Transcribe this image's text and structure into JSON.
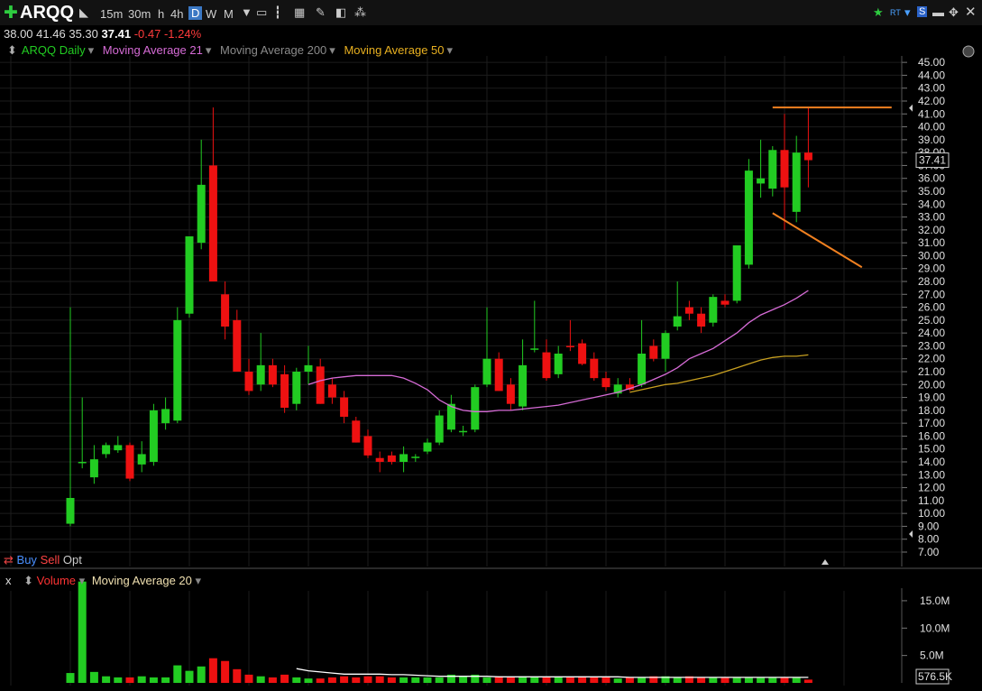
{
  "toolbar": {
    "symbol": "ARQQ",
    "timeframes": [
      "15m",
      "30m",
      "h",
      "4h",
      "D",
      "W",
      "M"
    ],
    "selected_timeframe": "D"
  },
  "ohlc": {
    "open": "38.00",
    "high": "41.46",
    "low": "35.30",
    "close": "37.41",
    "change": "-0.47",
    "change_pct": "-1.24%"
  },
  "legend": {
    "main": "ARQQ Daily",
    "ma21": "Moving Average 21",
    "ma200": "Moving Average 200",
    "ma50": "Moving Average 50"
  },
  "trade": {
    "buy": "Buy",
    "sell": "Sell",
    "opt": "Opt"
  },
  "volume_panel": {
    "close": "x",
    "label": "Volume",
    "ma": "Moving Average 20"
  },
  "colors": {
    "up": "#22cc22",
    "down": "#ee1111",
    "ma21": "#d66bd6",
    "ma50": "#c8a020",
    "ma200": "#999999",
    "trend": "#f08020",
    "vol_ma": "#ffffff"
  },
  "chart_data": {
    "type": "candlestick",
    "ylim": [
      7,
      45.5
    ],
    "y_ticks": [
      "7.00",
      "8.00",
      "9.00",
      "10.00",
      "11.00",
      "12.00",
      "13.00",
      "14.00",
      "15.00",
      "16.00",
      "17.00",
      "18.00",
      "19.00",
      "20.00",
      "21.00",
      "22.00",
      "23.00",
      "24.00",
      "25.00",
      "26.00",
      "27.00",
      "28.00",
      "29.00",
      "30.00",
      "31.00",
      "32.00",
      "33.00",
      "34.00",
      "35.00",
      "36.00",
      "37.00",
      "38.00",
      "39.00",
      "40.00",
      "41.00",
      "42.00",
      "43.00",
      "44.00",
      "45.00"
    ],
    "last_price": "37.41",
    "candles": [
      {
        "o": 9.2,
        "h": 26,
        "l": 9.0,
        "c": 11.2
      },
      {
        "o": 14,
        "h": 19,
        "l": 13.5,
        "c": 14
      },
      {
        "o": 12.8,
        "h": 15.3,
        "l": 12.3,
        "c": 14.2
      },
      {
        "o": 14.6,
        "h": 15.5,
        "l": 14.3,
        "c": 15.3
      },
      {
        "o": 14.9,
        "h": 16.0,
        "l": 14.7,
        "c": 15.3
      },
      {
        "o": 15.3,
        "h": 15.5,
        "l": 12.5,
        "c": 12.7
      },
      {
        "o": 13.8,
        "h": 15.6,
        "l": 13.2,
        "c": 14.6
      },
      {
        "o": 14.0,
        "h": 18.5,
        "l": 13.7,
        "c": 18.0
      },
      {
        "o": 17.0,
        "h": 19.0,
        "l": 16.5,
        "c": 18.1
      },
      {
        "o": 17.2,
        "h": 26.0,
        "l": 17.0,
        "c": 25.0
      },
      {
        "o": 25.5,
        "h": 31.5,
        "l": 25.2,
        "c": 31.5
      },
      {
        "o": 31.0,
        "h": 39.0,
        "l": 30.5,
        "c": 35.5
      },
      {
        "o": 37.0,
        "h": 41.5,
        "l": 28.0,
        "c": 28.0
      },
      {
        "o": 27.0,
        "h": 28.0,
        "l": 23.5,
        "c": 24.5
      },
      {
        "o": 25.0,
        "h": 25.8,
        "l": 21.0,
        "c": 21.0
      },
      {
        "o": 21.0,
        "h": 22.0,
        "l": 19.2,
        "c": 19.5
      },
      {
        "o": 20.0,
        "h": 24.0,
        "l": 19.5,
        "c": 21.5
      },
      {
        "o": 21.5,
        "h": 22.0,
        "l": 19.8,
        "c": 20.0
      },
      {
        "o": 20.8,
        "h": 21.5,
        "l": 17.8,
        "c": 18.2
      },
      {
        "o": 18.5,
        "h": 21.3,
        "l": 18.0,
        "c": 21.0
      },
      {
        "o": 21.0,
        "h": 23.0,
        "l": 20.0,
        "c": 21.5
      },
      {
        "o": 21.4,
        "h": 22.0,
        "l": 18.5,
        "c": 18.5
      },
      {
        "o": 20.0,
        "h": 20.5,
        "l": 18.5,
        "c": 19.0
      },
      {
        "o": 19.0,
        "h": 19.5,
        "l": 17.0,
        "c": 17.5
      },
      {
        "o": 17.2,
        "h": 17.5,
        "l": 15.5,
        "c": 15.5
      },
      {
        "o": 16.0,
        "h": 16.5,
        "l": 14.3,
        "c": 14.5
      },
      {
        "o": 14.3,
        "h": 14.8,
        "l": 13.2,
        "c": 14.0
      },
      {
        "o": 14.5,
        "h": 14.8,
        "l": 13.8,
        "c": 14.0
      },
      {
        "o": 14.0,
        "h": 15.2,
        "l": 13.2,
        "c": 14.6
      },
      {
        "o": 14.3,
        "h": 14.6,
        "l": 14.0,
        "c": 14.4
      },
      {
        "o": 14.8,
        "h": 15.8,
        "l": 14.6,
        "c": 15.5
      },
      {
        "o": 15.5,
        "h": 18.0,
        "l": 15.3,
        "c": 17.6
      },
      {
        "o": 16.5,
        "h": 19.2,
        "l": 16.3,
        "c": 18.5
      },
      {
        "o": 16.4,
        "h": 16.8,
        "l": 16.0,
        "c": 16.4
      },
      {
        "o": 16.5,
        "h": 20.0,
        "l": 16.3,
        "c": 19.8
      },
      {
        "o": 20.0,
        "h": 26.0,
        "l": 19.8,
        "c": 22.0
      },
      {
        "o": 22.0,
        "h": 22.5,
        "l": 19.5,
        "c": 19.5
      },
      {
        "o": 20.0,
        "h": 20.5,
        "l": 18.0,
        "c": 18.5
      },
      {
        "o": 18.3,
        "h": 23.5,
        "l": 18.0,
        "c": 21.5
      },
      {
        "o": 22.8,
        "h": 26.5,
        "l": 22.5,
        "c": 22.8
      },
      {
        "o": 22.5,
        "h": 23.5,
        "l": 20.3,
        "c": 20.5
      },
      {
        "o": 20.8,
        "h": 23.0,
        "l": 20.5,
        "c": 22.4
      },
      {
        "o": 23.0,
        "h": 25.0,
        "l": 22.6,
        "c": 22.9
      },
      {
        "o": 23.2,
        "h": 23.5,
        "l": 21.5,
        "c": 21.6
      },
      {
        "o": 22.0,
        "h": 22.5,
        "l": 20.3,
        "c": 20.5
      },
      {
        "o": 20.5,
        "h": 21.0,
        "l": 19.5,
        "c": 19.8
      },
      {
        "o": 19.3,
        "h": 20.5,
        "l": 19.0,
        "c": 20.0
      },
      {
        "o": 20.0,
        "h": 20.5,
        "l": 19.5,
        "c": 19.6
      },
      {
        "o": 20.0,
        "h": 25.0,
        "l": 19.8,
        "c": 22.4
      },
      {
        "o": 23.0,
        "h": 23.5,
        "l": 21.8,
        "c": 22.0
      },
      {
        "o": 22.0,
        "h": 24.2,
        "l": 21.0,
        "c": 24.0
      },
      {
        "o": 24.5,
        "h": 28.0,
        "l": 24.2,
        "c": 25.3
      },
      {
        "o": 26.0,
        "h": 26.5,
        "l": 25.0,
        "c": 25.5
      },
      {
        "o": 25.5,
        "h": 26.0,
        "l": 24.0,
        "c": 24.5
      },
      {
        "o": 24.8,
        "h": 27.0,
        "l": 24.5,
        "c": 26.8
      },
      {
        "o": 26.5,
        "h": 27.0,
        "l": 26.0,
        "c": 26.2
      },
      {
        "o": 26.5,
        "h": 29.0,
        "l": 26.3,
        "c": 30.8
      },
      {
        "o": 29.3,
        "h": 37.5,
        "l": 29.0,
        "c": 36.6
      },
      {
        "o": 35.6,
        "h": 39.0,
        "l": 34.5,
        "c": 36.0
      },
      {
        "o": 35.2,
        "h": 38.5,
        "l": 34.6,
        "c": 38.2
      },
      {
        "o": 38.2,
        "h": 41.0,
        "l": 32.0,
        "c": 35.3
      },
      {
        "o": 33.4,
        "h": 39.3,
        "l": 32.6,
        "c": 38.0
      },
      {
        "o": 38.0,
        "h": 41.46,
        "l": 35.3,
        "c": 37.41
      }
    ],
    "ma21": [
      null,
      null,
      null,
      null,
      null,
      null,
      null,
      null,
      null,
      null,
      null,
      null,
      null,
      null,
      null,
      null,
      null,
      null,
      null,
      null,
      20.0,
      20.3,
      20.5,
      20.6,
      20.7,
      20.7,
      20.7,
      20.7,
      20.5,
      20.1,
      19.6,
      18.8,
      18.3,
      18.0,
      17.9,
      17.9,
      18.0,
      18.0,
      18.1,
      18.2,
      18.3,
      18.4,
      18.6,
      18.8,
      19.0,
      19.2,
      19.4,
      19.7,
      20.0,
      20.4,
      20.8,
      21.3,
      22.0,
      22.4,
      22.8,
      23.4,
      24.0,
      24.8,
      25.4,
      25.8,
      26.2,
      26.7,
      27.3
    ],
    "ma50": [
      null,
      null,
      null,
      null,
      null,
      null,
      null,
      null,
      null,
      null,
      null,
      null,
      null,
      null,
      null,
      null,
      null,
      null,
      null,
      null,
      null,
      null,
      null,
      null,
      null,
      null,
      null,
      null,
      null,
      null,
      null,
      null,
      null,
      null,
      null,
      null,
      null,
      null,
      null,
      null,
      null,
      null,
      null,
      null,
      null,
      null,
      null,
      19.4,
      19.6,
      19.8,
      20.0,
      20.1,
      20.3,
      20.5,
      20.7,
      21.0,
      21.3,
      21.6,
      21.9,
      22.1,
      22.2,
      22.2,
      22.3
    ],
    "annotations": [
      {
        "type": "hline",
        "y": 41.5,
        "from": 59,
        "to": 69
      },
      {
        "type": "trend",
        "x1": 59,
        "y1": 33.3,
        "x2": 66.5,
        "y2": 29.1
      }
    ],
    "volume": {
      "y_ticks": [
        "5.0M",
        "10.0M",
        "15.0M"
      ],
      "ylim": [
        0,
        16.8
      ],
      "last": "576.5K",
      "values": [
        1.8,
        18.5,
        2.0,
        1.2,
        1.0,
        1.0,
        1.2,
        1.0,
        1.0,
        3.2,
        2.2,
        3.0,
        4.5,
        4.0,
        2.5,
        1.5,
        1.2,
        1.0,
        1.5,
        1.0,
        0.8,
        0.8,
        1.0,
        1.2,
        1.0,
        1.2,
        1.2,
        1.0,
        1.0,
        1.0,
        1.0,
        1.0,
        1.5,
        1.2,
        1.5,
        1.0,
        1.2,
        1.0,
        1.2,
        1.0,
        1.0,
        1.0,
        1.0,
        1.2,
        1.0,
        1.0,
        0.8,
        1.0,
        1.0,
        1.2,
        1.2,
        1.0,
        1.2,
        1.0,
        1.0,
        0.9,
        0.9,
        0.9,
        0.9,
        0.9,
        1.0,
        0.9,
        0.6
      ],
      "ma20": [
        null,
        null,
        null,
        null,
        null,
        null,
        null,
        null,
        null,
        null,
        null,
        null,
        null,
        null,
        null,
        null,
        null,
        null,
        null,
        2.6,
        2.2,
        2.0,
        1.8,
        1.6,
        1.6,
        1.6,
        1.6,
        1.5,
        1.5,
        1.4,
        1.3,
        1.2,
        1.2,
        1.2,
        1.2,
        1.2,
        1.1,
        1.1,
        1.1,
        1.1,
        1.1,
        1.1,
        1.1,
        1.1,
        1.1,
        1.1,
        1.1,
        1.0,
        1.0,
        1.0,
        1.0,
        1.0,
        1.0,
        1.0,
        1.0,
        1.0,
        1.0,
        1.0,
        1.0,
        1.0,
        1.0,
        1.0,
        1.0
      ]
    }
  }
}
